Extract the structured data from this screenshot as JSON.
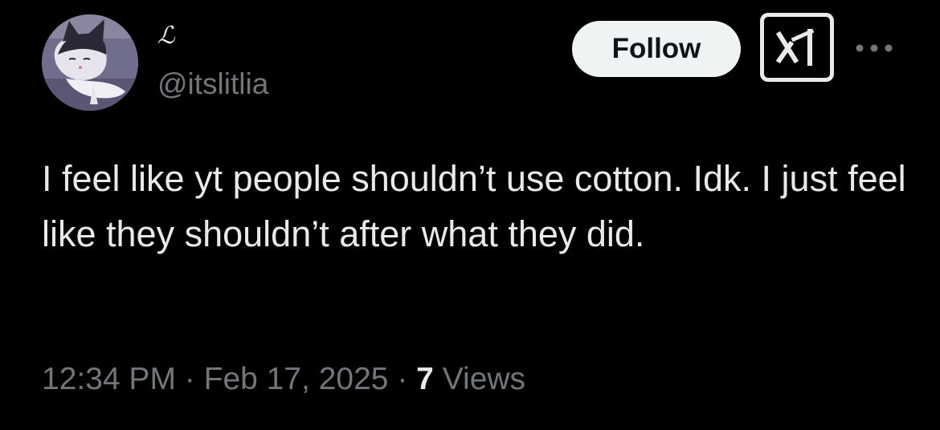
{
  "user": {
    "display_name": "ℒ",
    "handle": "@itslitlia",
    "avatar_icon": "kuromi-sleeping-avatar"
  },
  "actions": {
    "follow_label": "Follow",
    "grok_icon": "grok-icon",
    "more_icon": "more-options-icon"
  },
  "tweet": {
    "text": "I feel like yt people shouldn’t use cotton. Idk. I just feel like they shouldn’t after what they did."
  },
  "meta": {
    "time": "12:34 PM",
    "separator": "·",
    "date": "Feb 17, 2025",
    "views_count": "7",
    "views_label": "Views"
  },
  "colors": {
    "background": "#000000",
    "primary_text": "#e7e9ea",
    "secondary_text": "#71767b",
    "follow_bg": "#eff3f4",
    "follow_text": "#0f1419"
  }
}
